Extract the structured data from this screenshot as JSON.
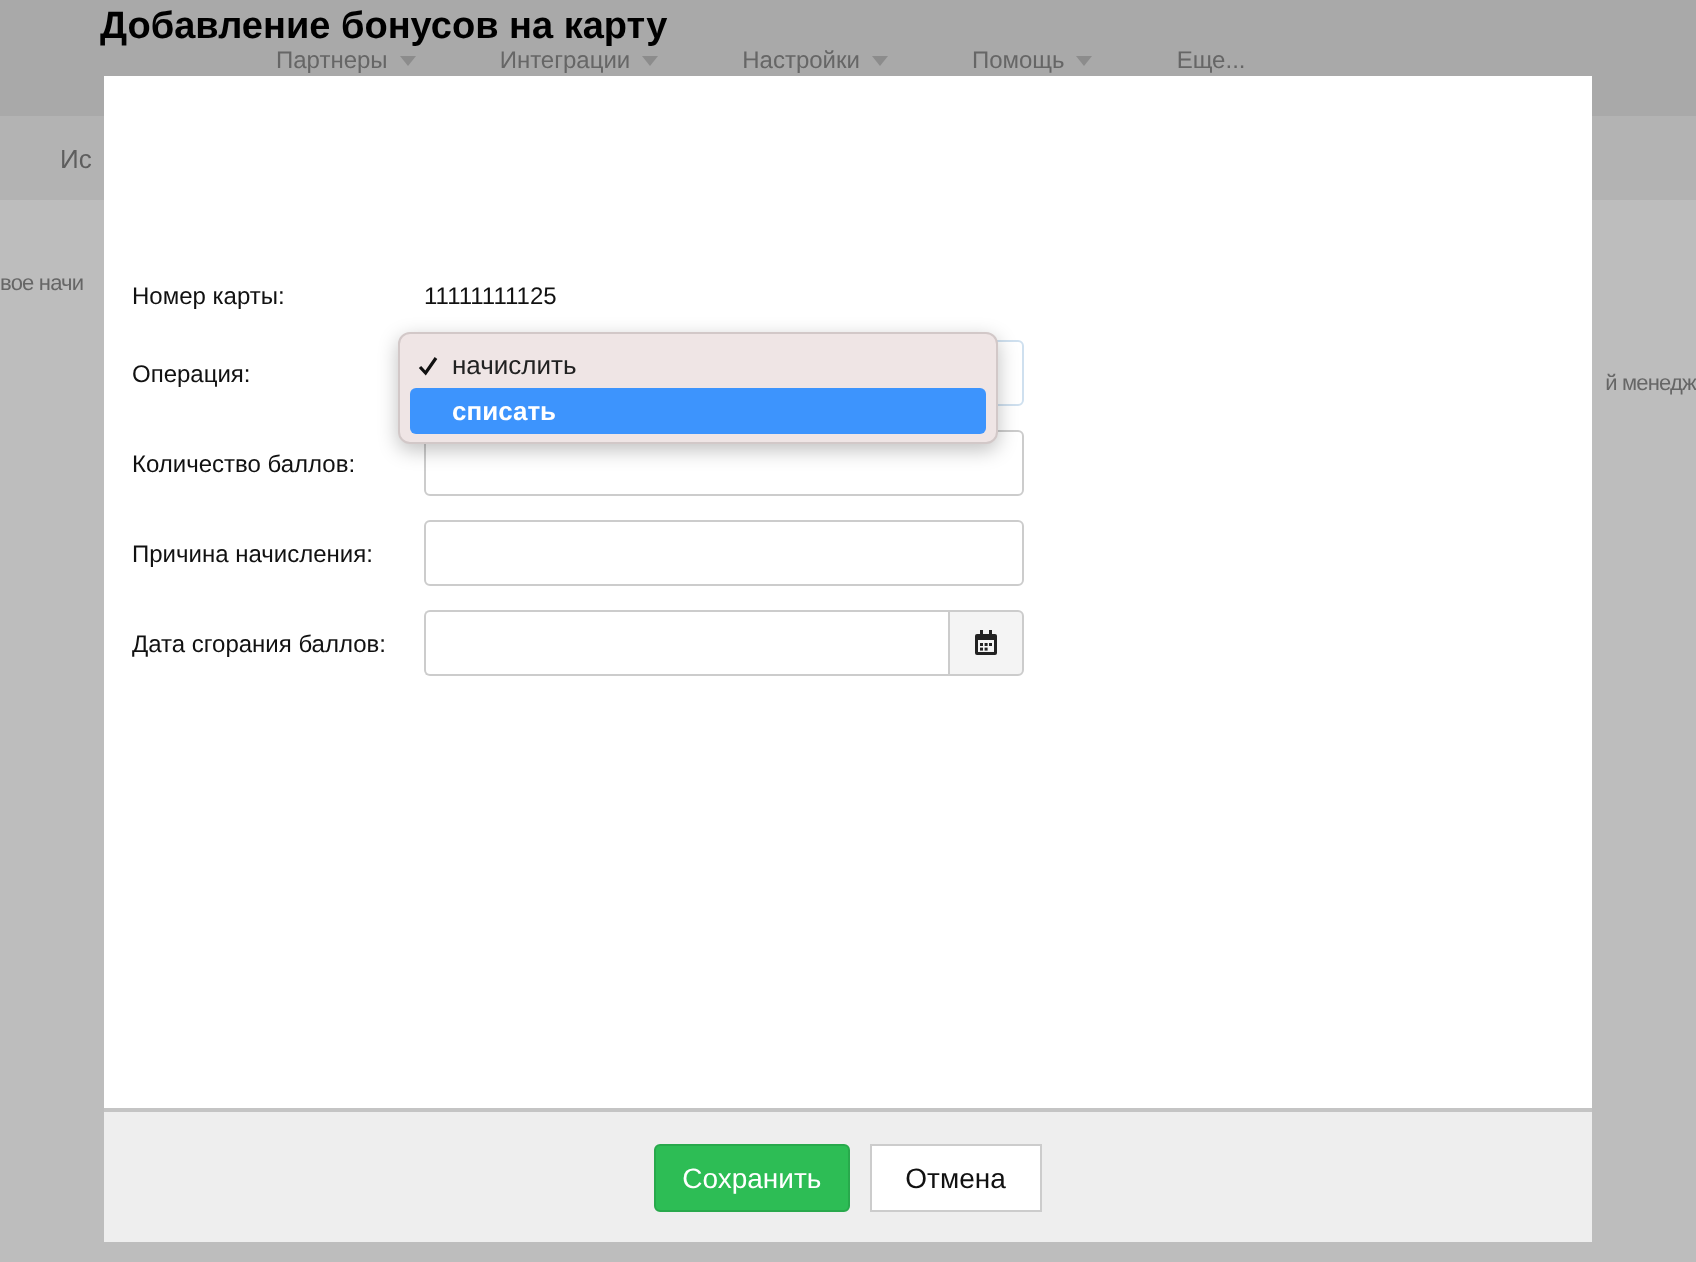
{
  "background": {
    "nav": [
      {
        "label": "Партнеры",
        "caret": true
      },
      {
        "label": "Интеграции",
        "caret": true
      },
      {
        "label": "Настройки",
        "caret": true
      },
      {
        "label": "Помощь",
        "caret": true
      },
      {
        "label": "Еще...",
        "caret": false
      }
    ],
    "subnav": "Ис",
    "left_fragment": "вое начи",
    "right_fragment": "й менедж"
  },
  "dialog": {
    "title": "Добавление бонусов на карту",
    "fields": [
      {
        "kind": "text",
        "label": "Номер карты:",
        "value": "11111111125"
      },
      {
        "kind": "select",
        "label": "Операция:",
        "options": [
          {
            "label": "начислить",
            "checked": true,
            "selected": false
          },
          {
            "label": "списать",
            "checked": false,
            "selected": true
          }
        ]
      },
      {
        "kind": "input",
        "label": "Количество баллов:"
      },
      {
        "kind": "input",
        "label": "Причина начисления:"
      },
      {
        "kind": "date",
        "label": "Дата сгорания баллов:"
      }
    ],
    "buttons": [
      {
        "label": "Сохранить",
        "kind": "primary"
      },
      {
        "label": "Отмена",
        "kind": "secondary"
      }
    ]
  }
}
